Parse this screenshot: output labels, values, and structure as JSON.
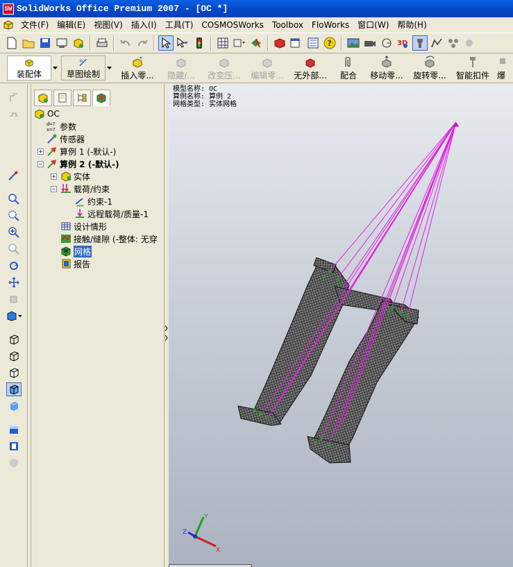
{
  "window": {
    "title": "SolidWorks Office Premium 2007 - [OC *]",
    "logo_text": "SW"
  },
  "menu": [
    "文件(F)",
    "编辑(E)",
    "视图(V)",
    "插入(I)",
    "工具(T)",
    "COSMOSWorks",
    "Toolbox",
    "FloWorks",
    "窗口(W)",
    "帮助(H)"
  ],
  "command_manager": {
    "buttons": [
      {
        "label": "装配体",
        "state": "active"
      },
      {
        "label": "草图绘制",
        "state": "normal"
      },
      {
        "label": "插入零...",
        "state": "normal"
      },
      {
        "label": "隐藏/...",
        "state": "disabled"
      },
      {
        "label": "改变压...",
        "state": "disabled"
      },
      {
        "label": "编辑零...",
        "state": "disabled"
      },
      {
        "label": "无外部...",
        "state": "normal"
      },
      {
        "label": "配合",
        "state": "normal"
      },
      {
        "label": "移动零...",
        "state": "normal"
      },
      {
        "label": "旋转零...",
        "state": "normal"
      },
      {
        "label": "智能扣件",
        "state": "normal"
      },
      {
        "label": "爆",
        "state": "normal"
      }
    ]
  },
  "tree": {
    "root": "OC",
    "items": {
      "params": "参数",
      "sensors": "传感器",
      "study1": "算例 1 (-默认-)",
      "study2": "算例 2 (-默认-)",
      "solids": "实体",
      "loads": "载荷/约束",
      "restraint1": "约束-1",
      "remote_load": "远程载荷/质量-1",
      "design_scenario": "设计情形",
      "contact": "接触/缝隙 (-整体: 无穿",
      "mesh": "网格",
      "report": "报告"
    }
  },
  "viewport": {
    "info_lines": [
      "模型名称: OC",
      "算例名称: 算例 2",
      "网格类型: 实体网格"
    ],
    "triad": {
      "x": "X",
      "y": "Y",
      "z": "Z"
    },
    "load_line_color": "#e020e0"
  }
}
